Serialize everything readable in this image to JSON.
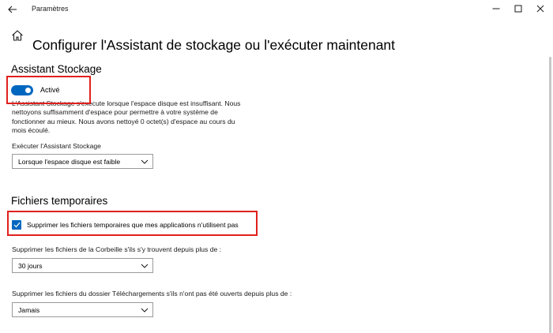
{
  "window": {
    "app_title": "Paramètres",
    "back_icon": "arrow-left-icon",
    "controls": [
      "minimize-icon",
      "maximize-icon",
      "close-icon"
    ]
  },
  "page": {
    "home_icon": "home-icon",
    "title": "Configurer l'Assistant de stockage ou l'exécuter maintenant"
  },
  "storage_sense": {
    "section_title": "Assistant Stockage",
    "toggle_state": "Activé",
    "toggle_on": true,
    "description": "L'Assistant Stockage s'exécute lorsque l'espace disque est insuffisant. Nous nettoyons suffisamment d'espace pour permettre à votre système de fonctionner au mieux. Nous avons nettoyé 0 octet(s) d'espace au cours du mois écoulé.",
    "run_label": "Exécuter l'Assistant Stockage",
    "run_value": "Lorsque l'espace disque est faible"
  },
  "temp_files": {
    "section_title": "Fichiers temporaires",
    "checkbox_label": "Supprimer les fichiers temporaires que mes applications n'utilisent pas",
    "checkbox_checked": true,
    "recycle_label": "Supprimer les fichiers de la Corbeille s'ils s'y trouvent depuis plus de :",
    "recycle_value": "30 jours",
    "downloads_label": "Supprimer les fichiers du dossier Téléchargements s'ils n'ont pas été ouverts depuis plus de :",
    "downloads_value": "Jamais"
  },
  "colors": {
    "accent": "#0067c0",
    "highlight": "#e0201c"
  }
}
